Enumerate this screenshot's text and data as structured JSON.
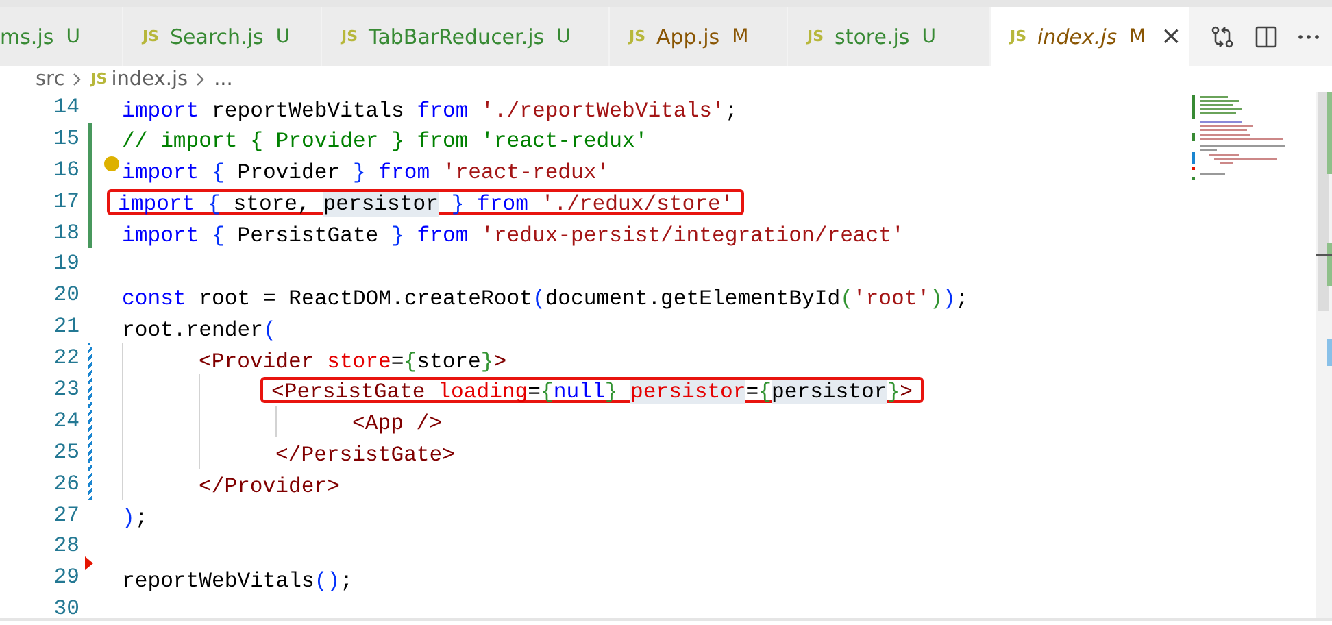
{
  "tabs": [
    {
      "label": "ms.js",
      "status": "U",
      "kind": "untracked",
      "selected": false
    },
    {
      "icon": "JS",
      "label": "Search.js",
      "status": "U",
      "kind": "untracked",
      "selected": false
    },
    {
      "icon": "JS",
      "label": "TabBarReducer.js",
      "status": "U",
      "kind": "untracked",
      "selected": false
    },
    {
      "icon": "JS",
      "label": "App.js",
      "status": "M",
      "kind": "modified",
      "selected": false
    },
    {
      "icon": "JS",
      "label": "store.js",
      "status": "U",
      "kind": "untracked",
      "selected": false
    },
    {
      "icon": "JS",
      "label": "index.js",
      "status": "M",
      "kind": "modified",
      "selected": true,
      "italic": true,
      "close": "×"
    }
  ],
  "breadcrumbs": [
    {
      "kind": "folder",
      "label": "src"
    },
    {
      "kind": "file",
      "icon": "JS",
      "label": "index.js"
    },
    {
      "kind": "more",
      "label": "..."
    }
  ],
  "lines": [
    {
      "number": "14",
      "tokens": [
        {
          "kind": "keyword",
          "t": "import"
        },
        {
          "kind": "plain",
          "t": " reportWebVitals "
        },
        {
          "kind": "keyword",
          "t": "from"
        },
        {
          "kind": "string",
          "t": " './reportWebVitals'"
        },
        {
          "kind": "plain",
          "t": ";"
        }
      ]
    },
    {
      "number": "15",
      "kind": "added",
      "tokens": [
        {
          "kind": "comment",
          "t": "// import { Provider } from 'react-redux'"
        }
      ]
    },
    {
      "number": "16",
      "kind": "added",
      "lightbulb": true,
      "tokens": [
        {
          "kind": "keyword",
          "t": "import"
        },
        {
          "kind": "bracket1",
          "t": " {"
        },
        {
          "kind": "plain",
          "t": " Provider "
        },
        {
          "kind": "bracket1",
          "t": "}"
        },
        {
          "kind": "keyword",
          "t": " from"
        },
        {
          "kind": "string",
          "t": " 'react-redux'"
        }
      ]
    },
    {
      "number": "17",
      "kind": "added",
      "boxed": true,
      "tokens": [
        {
          "kind": "keyword",
          "t": "import"
        },
        {
          "kind": "bracket1",
          "t": " {"
        },
        {
          "kind": "plain",
          "t": " store, "
        },
        {
          "kind": "plain",
          "t": "persistor",
          "hl": true
        },
        {
          "kind": "bracket1",
          "t": " }"
        },
        {
          "kind": "keyword",
          "t": " from"
        },
        {
          "kind": "string",
          "t": " './redux/store'"
        }
      ]
    },
    {
      "number": "18",
      "kind": "added",
      "tokens": [
        {
          "kind": "keyword",
          "t": "import"
        },
        {
          "kind": "bracket1",
          "t": " {"
        },
        {
          "kind": "plain",
          "t": " PersistGate "
        },
        {
          "kind": "bracket1",
          "t": "}"
        },
        {
          "kind": "keyword",
          "t": " from"
        },
        {
          "kind": "string",
          "t": " 'redux-persist/integration/react'"
        }
      ]
    },
    {
      "number": "19"
    },
    {
      "number": "20",
      "tokens": [
        {
          "kind": "keyword",
          "t": "const"
        },
        {
          "kind": "plain",
          "t": " root = ReactDOM.createRoot"
        },
        {
          "kind": "bracket1",
          "t": "("
        },
        {
          "kind": "plain",
          "t": "document.getElementById"
        },
        {
          "kind": "bracket2",
          "t": "("
        },
        {
          "kind": "string",
          "t": "'root'"
        },
        {
          "kind": "bracket2",
          "t": ")"
        },
        {
          "kind": "bracket1",
          "t": ")"
        },
        {
          "kind": "plain",
          "t": ";"
        }
      ]
    },
    {
      "number": "21",
      "tokens": [
        {
          "kind": "plain",
          "t": "root.render"
        },
        {
          "kind": "bracket1",
          "t": "("
        }
      ],
      "children": [
        {
          "number": "22",
          "kind": "modified",
          "tokens": [
            {
              "kind": "tag",
              "t": "<Provider"
            },
            {
              "kind": "attr",
              "t": " store"
            },
            {
              "kind": "plain",
              "t": "="
            },
            {
              "kind": "bracket2",
              "t": "{"
            },
            {
              "kind": "plain",
              "t": "store"
            },
            {
              "kind": "bracket2",
              "t": "}"
            },
            {
              "kind": "tag",
              "t": ">"
            }
          ],
          "children": [
            {
              "number": "23",
              "kind": "modified",
              "boxed": true,
              "tokens": [
                {
                  "kind": "tag",
                  "t": "<PersistGate"
                },
                {
                  "kind": "attr",
                  "t": " loading"
                },
                {
                  "kind": "plain",
                  "t": "="
                },
                {
                  "kind": "bracket2",
                  "t": "{"
                },
                {
                  "kind": "keyword",
                  "t": "null"
                },
                {
                  "kind": "bracket2",
                  "t": "} "
                },
                {
                  "kind": "attr",
                  "t": "persistor",
                  "hl": true
                },
                {
                  "kind": "plain",
                  "t": "="
                },
                {
                  "kind": "bracket2",
                  "t": "{"
                },
                {
                  "kind": "plain",
                  "t": "persistor",
                  "hl": true
                },
                {
                  "kind": "bracket2",
                  "t": "}"
                },
                {
                  "kind": "tag",
                  "t": ">"
                }
              ],
              "children": [
                {
                  "number": "24",
                  "kind": "modified",
                  "tokens": [
                    {
                      "kind": "tag",
                      "t": "<App />"
                    }
                  ]
                }
              ]
            },
            {
              "number": "25",
              "kind": "modified",
              "tokens": [
                {
                  "kind": "tag",
                  "t": "</PersistGate>"
                }
              ]
            }
          ]
        },
        {
          "number": "26",
          "kind": "modified",
          "tokens": [
            {
              "kind": "tag",
              "t": "</Provider>"
            }
          ]
        }
      ]
    },
    {
      "number": "27",
      "tokens": [
        {
          "kind": "bracket1",
          "t": ")"
        },
        {
          "kind": "plain",
          "t": ";"
        }
      ]
    },
    {
      "number": "28"
    },
    {
      "number": "29",
      "kind": "deleted",
      "tokens": [
        {
          "kind": "plain",
          "t": "reportWebVitals"
        },
        {
          "kind": "bracket1",
          "t": "()"
        },
        {
          "kind": "plain",
          "t": ";"
        }
      ]
    },
    {
      "number": "30"
    }
  ]
}
